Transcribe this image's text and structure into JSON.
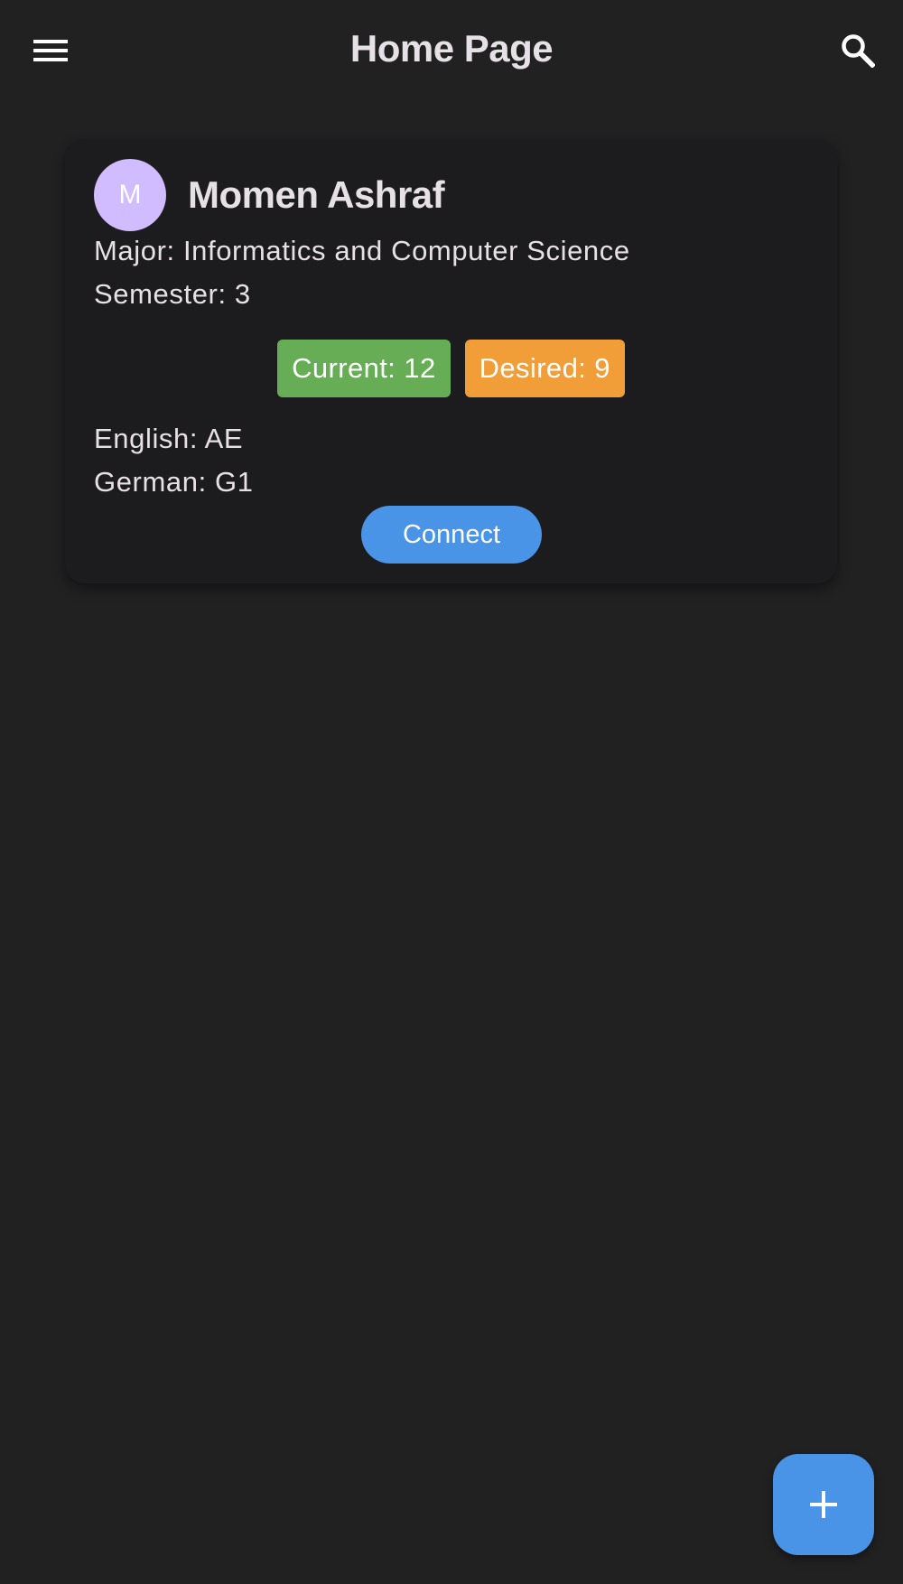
{
  "app_bar": {
    "title": "Home Page",
    "menu_icon": "hamburger-menu-icon",
    "search_icon": "search-icon"
  },
  "profile_card": {
    "avatar_initial": "M",
    "avatar_color": "#d0bcff",
    "name": "Momen Ashraf",
    "major": "Major: Informatics and Computer Science",
    "semester": "Semester: 3",
    "current_chip": "Current: 12",
    "current_chip_color": "#66ad56",
    "desired_chip": "Desired: 9",
    "desired_chip_color": "#f29e38",
    "english": "English: AE",
    "german": "German: G1",
    "connect_label": "Connect",
    "connect_color": "#4a94e8"
  },
  "fab": {
    "icon": "plus-icon",
    "color": "#4a94e8"
  },
  "colors": {
    "background": "#212121",
    "card": "#1c1b1d",
    "text": "#e6e1e5"
  }
}
